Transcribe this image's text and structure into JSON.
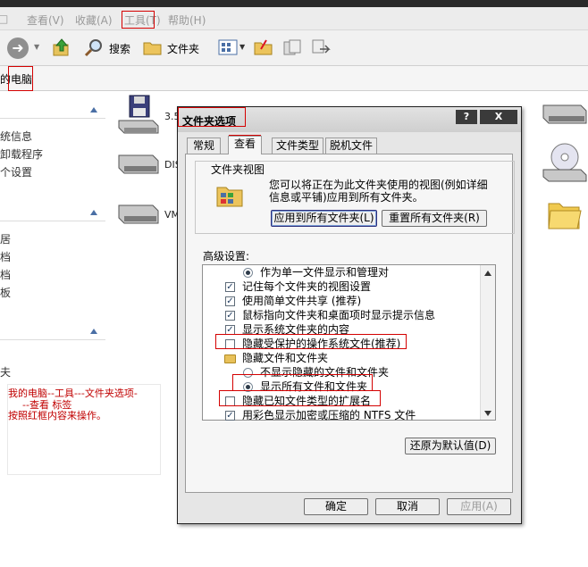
{
  "explorer": {
    "menu": [
      {
        "label": "查看(V)"
      },
      {
        "label": "收藏(A)"
      },
      {
        "label": "工具(T)"
      },
      {
        "label": "帮助(H)"
      }
    ],
    "toolbar": {
      "search_label": "搜索",
      "folders_label": "文件夹"
    },
    "address_text": "的电脑",
    "taskpane": {
      "group1": [
        "统信息",
        "卸载程序",
        "个设置"
      ],
      "group2": [
        "居",
        "档",
        "档",
        "板"
      ],
      "group3": [
        "夫"
      ]
    },
    "drives": [
      {
        "label": "3.5"
      },
      {
        "label": "DIS"
      },
      {
        "label": "VM"
      }
    ],
    "note": {
      "line1": "我的电脑--工具---文件夹选项-",
      "line2": "--查看 标签",
      "line3": "按照红框内容来操作。"
    }
  },
  "dialog": {
    "title": "文件夹选项",
    "help_button": "?",
    "close_button": "X",
    "tabs": [
      {
        "label": "常规"
      },
      {
        "label": "查看"
      },
      {
        "label": "文件类型"
      },
      {
        "label": "脱机文件"
      }
    ],
    "folder_view": {
      "group_label": "文件夹视图",
      "description": "您可以将正在为此文件夹使用的视图(例如详细信息或平铺)应用到所有文件夹。",
      "apply_all_button": "应用到所有文件夹(L)",
      "reset_all_button": "重置所有文件夹(R)"
    },
    "advanced": {
      "label": "高级设置:",
      "items": [
        {
          "kind": "radio",
          "checked": true,
          "label": "作为单一文件显示和管理对"
        },
        {
          "kind": "checkbox",
          "checked": true,
          "label": "记住每个文件夹的视图设置"
        },
        {
          "kind": "checkbox",
          "checked": true,
          "label": "使用简单文件共享 (推荐)"
        },
        {
          "kind": "checkbox",
          "checked": true,
          "label": "鼠标指向文件夹和桌面项时显示提示信息"
        },
        {
          "kind": "checkbox",
          "checked": true,
          "label": "显示系统文件夹的内容"
        },
        {
          "kind": "checkbox",
          "checked": false,
          "label": "隐藏受保护的操作系统文件(推荐)"
        },
        {
          "kind": "folder",
          "label": "隐藏文件和文件夹"
        },
        {
          "kind": "radio",
          "checked": false,
          "label": "不显示隐藏的文件和文件夹"
        },
        {
          "kind": "radio",
          "checked": true,
          "label": "显示所有文件和文件夹"
        },
        {
          "kind": "checkbox",
          "checked": false,
          "label": "隐藏已知文件类型的扩展名"
        },
        {
          "kind": "checkbox",
          "checked": true,
          "label": "用彩色显示加密或压缩的 NTFS 文件"
        }
      ]
    },
    "restore_defaults_button": "还原为默认值(D)",
    "ok_button": "确定",
    "cancel_button": "取消",
    "apply_button": "应用(A)"
  },
  "colors": {
    "highlight": "#d40000",
    "note_text": "#c00000"
  }
}
